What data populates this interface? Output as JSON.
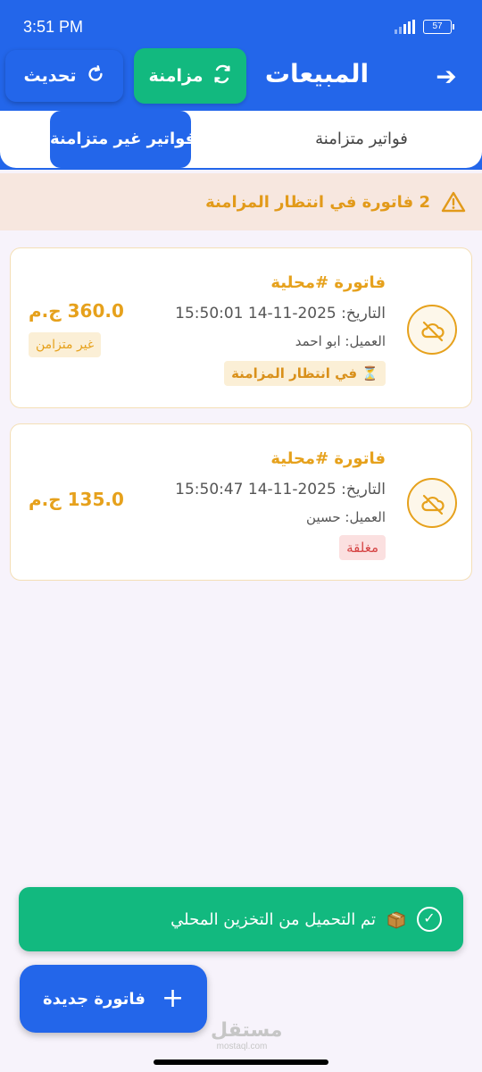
{
  "status_bar": {
    "time": "3:51 PM",
    "battery": "57"
  },
  "header": {
    "title": "المبيعات",
    "back_icon": "arrow-right-icon",
    "sync_label": "مزامنة",
    "refresh_label": "تحديث"
  },
  "tabs": [
    {
      "label": "فواتير متزامنة",
      "active": false
    },
    {
      "label": "فواتير غير متزامنة",
      "active": true
    }
  ],
  "banner": {
    "text": "2 فاتورة في انتظار المزامنة",
    "icon": "warning-icon"
  },
  "invoices": [
    {
      "title": "فاتورة #محلية",
      "date": "التاريخ: 2025-11-14 15:50:01",
      "client": "العميل: ابو احمد",
      "status": "⏳ في انتظار المزامنة",
      "amount": "360.0 ج.م",
      "sync_badge": "غير متزامن"
    },
    {
      "title": "فاتورة #محلية",
      "date": "التاريخ: 2025-11-14 15:50:47",
      "client": "العميل: حسين",
      "status": "مغلقة",
      "amount": "135.0 ج.م"
    }
  ],
  "toast": {
    "text": "تم التحميل من التخزين المحلي",
    "icon": "package-icon"
  },
  "fab": {
    "label": "فاتورة جديدة"
  },
  "watermark": {
    "ar": "مستقل",
    "en": "mostaql.com"
  },
  "colors": {
    "primary": "#2366ea",
    "success": "#12b97f",
    "warning": "#e6a11c",
    "danger": "#d64545"
  }
}
